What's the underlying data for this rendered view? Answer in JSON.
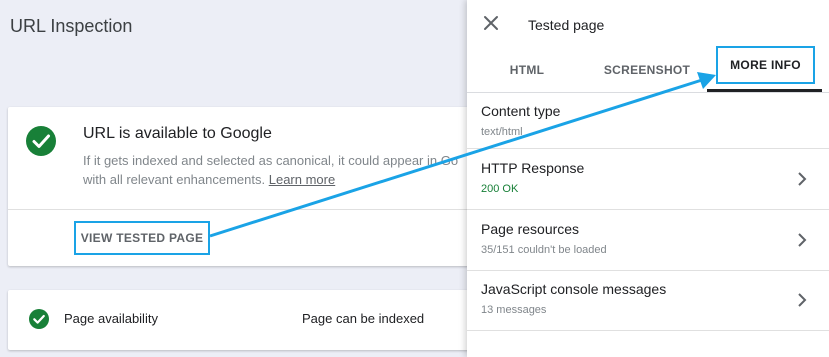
{
  "page": {
    "title": "URL Inspection"
  },
  "status_card": {
    "title": "URL is available to Google",
    "description_line1": "If it gets indexed and selected as canonical, it could appear in Go",
    "description_line2": "with all relevant enhancements.",
    "learn_more": "Learn more",
    "view_button": "VIEW TESTED PAGE"
  },
  "availability_card": {
    "label": "Page availability",
    "value": "Page can be indexed"
  },
  "panel": {
    "title": "Tested page",
    "tabs": [
      {
        "label": "HTML"
      },
      {
        "label": "SCREENSHOT"
      },
      {
        "label": "MORE INFO"
      }
    ],
    "rows": [
      {
        "label": "Content type",
        "value": "text/html"
      },
      {
        "label": "HTTP Response",
        "value": "200 OK"
      },
      {
        "label": "Page resources",
        "value": "35/151 couldn't be loaded"
      },
      {
        "label": "JavaScript console messages",
        "value": "13 messages"
      }
    ]
  },
  "colors": {
    "accent": "#1aa3e6",
    "success": "#188038",
    "background": "#eceef6"
  },
  "icons": [
    "check-circle-icon",
    "close-icon",
    "chevron-right-icon"
  ]
}
